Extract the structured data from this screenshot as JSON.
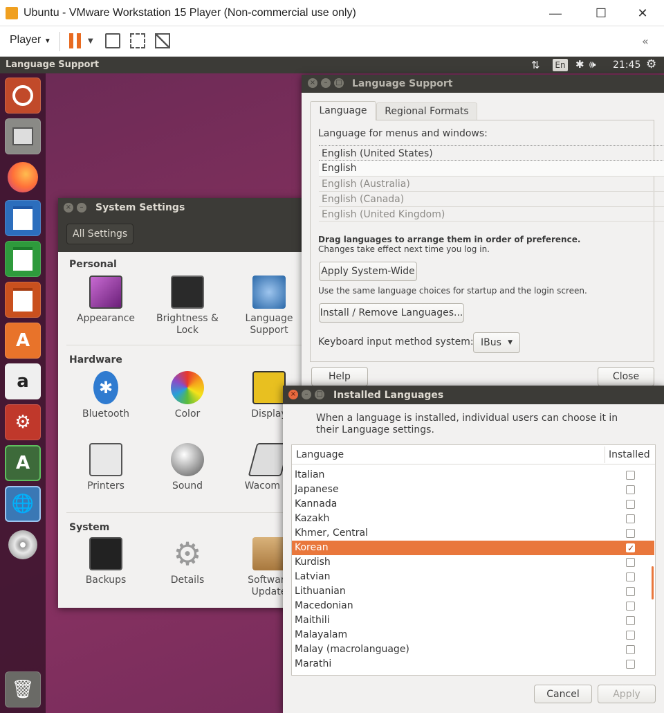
{
  "vm": {
    "title": "Ubuntu - VMware Workstation 15 Player (Non-commercial use only)",
    "player_label": "Player",
    "minimize": "—",
    "maximize": "☐",
    "close": "✕"
  },
  "topbar": {
    "app_name": "Language Support",
    "keyboard": "En",
    "time": "21:45"
  },
  "settings": {
    "title": "System Settings",
    "all_settings": "All Settings",
    "personal": {
      "heading": "Personal",
      "items": [
        {
          "label": "Appearance"
        },
        {
          "label": "Brightness &\nLock"
        },
        {
          "label": "Language\nSupport"
        }
      ]
    },
    "hardware": {
      "heading": "Hardware",
      "items": [
        {
          "label": "Bluetooth"
        },
        {
          "label": "Color"
        },
        {
          "label": "Display"
        },
        {
          "label": "Printers"
        },
        {
          "label": "Sound"
        },
        {
          "label": "Wacom Ta"
        }
      ]
    },
    "system": {
      "heading": "System",
      "items": [
        {
          "label": "Backups"
        },
        {
          "label": "Details"
        },
        {
          "label": "Software\nUpdate"
        }
      ]
    }
  },
  "lang_support": {
    "title": "Language Support",
    "tabs": [
      "Language",
      "Regional Formats"
    ],
    "menus_label": "Language for menus and windows:",
    "languages": [
      "English (United States)",
      "English",
      "English (Australia)",
      "English (Canada)",
      "English (United Kingdom)"
    ],
    "drag_hint": "Drag languages to arrange them in order of preference.",
    "drag_sub": "Changes take effect next time you log in.",
    "apply_system": "Apply System-Wide",
    "apply_hint": "Use the same language choices for startup and the login screen.",
    "install_remove": "Install / Remove Languages...",
    "keyboard_label": "Keyboard input method system:",
    "keyboard_value": "IBus",
    "help": "Help",
    "close": "Close"
  },
  "installed": {
    "title": "Installed Languages",
    "description": "When a language is installed, individual users can choose it in their Language settings.",
    "col_language": "Language",
    "col_installed": "Installed",
    "rows": [
      {
        "name": "Italian",
        "installed": false
      },
      {
        "name": "Japanese",
        "installed": false
      },
      {
        "name": "Kannada",
        "installed": false
      },
      {
        "name": "Kazakh",
        "installed": false
      },
      {
        "name": "Khmer, Central",
        "installed": false
      },
      {
        "name": "Korean",
        "installed": true,
        "selected": true
      },
      {
        "name": "Kurdish",
        "installed": false
      },
      {
        "name": "Latvian",
        "installed": false
      },
      {
        "name": "Lithuanian",
        "installed": false
      },
      {
        "name": "Macedonian",
        "installed": false
      },
      {
        "name": "Maithili",
        "installed": false
      },
      {
        "name": "Malayalam",
        "installed": false
      },
      {
        "name": "Malay (macrolanguage)",
        "installed": false
      },
      {
        "name": "Marathi",
        "installed": false
      }
    ],
    "cancel": "Cancel",
    "apply": "Apply"
  },
  "colors": {
    "accent": "#e9773c",
    "topbar": "#3c3b37",
    "desktop": "#7e2f5c"
  }
}
